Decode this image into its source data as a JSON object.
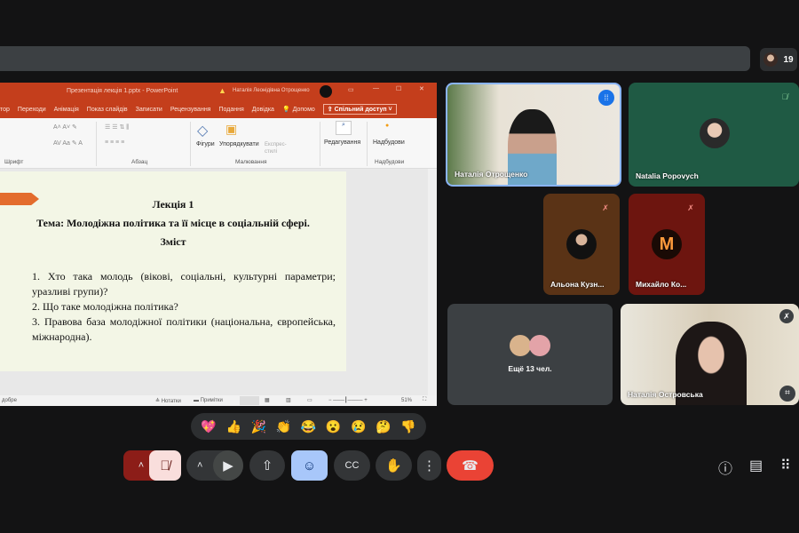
{
  "participants_count": "19",
  "ppt": {
    "title": "Презентація лекція 1.pptx - PowerPoint",
    "user": "Наталія Леонідівна Отрощенко",
    "tabs": [
      "тор",
      "Переходи",
      "Анімація",
      "Показ слайдів",
      "Записати",
      "Рецензування",
      "Подання",
      "Довідка",
      "Допомо"
    ],
    "share": "Спільний доступ",
    "ribbon": {
      "shapes": "Фігури",
      "arrange": "Упорядкувати",
      "styles": "Експрес-стилі",
      "editing": "Редагування",
      "addins": "Надбудови",
      "groups": [
        "Шрифт",
        "Абзац",
        "Малювання",
        "Надбудови"
      ]
    },
    "slide": {
      "lecture": "Лекція 1",
      "topic": "Тема: Молодіжна політика та її місце в соціальній сфері.",
      "contents": "Зміст",
      "items": [
        "Хто така молодь (вікові, соціальні, культурні параметри; уразливі групи)?",
        "Що таке молодіжна політика?",
        "Правова база молодіжної політики (національна, європейська, міжнародна)."
      ]
    },
    "status": {
      "left": "добре",
      "notes": "Нотатки",
      "comments": "Примітки",
      "zoom": "51%"
    }
  },
  "tiles": [
    {
      "name": "Наталія Отрощенко"
    },
    {
      "name": "Natalia Popovych"
    },
    {
      "name": "Альона Кузн..."
    },
    {
      "name": "Михайло Ко..."
    },
    {
      "name": "Ещё 13 чел."
    },
    {
      "name": "Наталія Островська"
    }
  ],
  "emoji": [
    "💖",
    "👍",
    "🎉",
    "👏",
    "😂",
    "😮",
    "😢",
    "🤔",
    "👎"
  ]
}
